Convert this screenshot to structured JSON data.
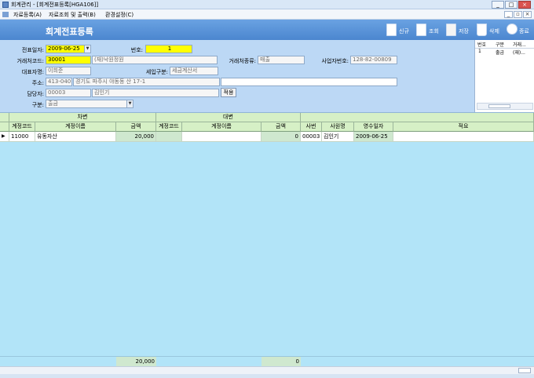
{
  "window": {
    "title": "회계관리 - [회계전표등록[HGA106]]"
  },
  "menu": {
    "items": [
      "자료등록(A)",
      "자료조회 및 출력(B)",
      "환경설정(C)"
    ]
  },
  "header": {
    "title": "회계전표등록",
    "buttons": [
      "신규",
      "조회",
      "저장",
      "삭제",
      "종료"
    ]
  },
  "form": {
    "date_label": "전표일자:",
    "date_value": "2009-06-25",
    "number_label": "번호:",
    "number_value": "1",
    "client_code_label": "거래처코드:",
    "client_code_value": "30001",
    "client_name_value": "(재)낙원정원",
    "client_type_label": "거래처종류:",
    "client_type_value": "매출",
    "biz_no_label": "사업자번호:",
    "biz_no_value": "128-82-00809",
    "rep_label": "대표자명:",
    "rep_value": "이희준",
    "tax_label": "세입구분:",
    "tax_value": "세금계산서",
    "addr_label": "주소:",
    "zip_value": "413-040",
    "addr_value": "경기도 파주시 야동동 산 17-1",
    "manager_label": "담당자:",
    "manager_code": "00003",
    "manager_name": "김인기",
    "apply_button": "적용",
    "type_label": "구분:",
    "type_value": "출금"
  },
  "minilist": {
    "headers": [
      "번호",
      "구분",
      "거래..."
    ],
    "rows": [
      [
        "1",
        "출금",
        "(재)..."
      ]
    ]
  },
  "grid": {
    "group_debit": "차변",
    "group_credit": "대변",
    "columns": [
      "계정코드",
      "계정이름",
      "금액",
      "계정코드",
      "계정이름",
      "금액",
      "사번",
      "사원명",
      "영수일자",
      "적요"
    ],
    "rows": [
      {
        "marker": "▶",
        "d_code": "11000",
        "d_name": "유동자산",
        "d_amount": "20,000",
        "c_code": "",
        "c_name": "",
        "c_amount": "0",
        "emp_no": "00003",
        "emp_name": "김인기",
        "date": "2009-06-25",
        "memo": ""
      }
    ]
  },
  "totals": {
    "debit": "20,000",
    "credit": "0"
  },
  "colors": {
    "header_blue": "#4b86cf",
    "form_blue": "#bcd8f5",
    "grid_cyan": "#b2e4f8",
    "grid_header_green": "#d6f0c6",
    "required_yellow": "#ffff00"
  }
}
